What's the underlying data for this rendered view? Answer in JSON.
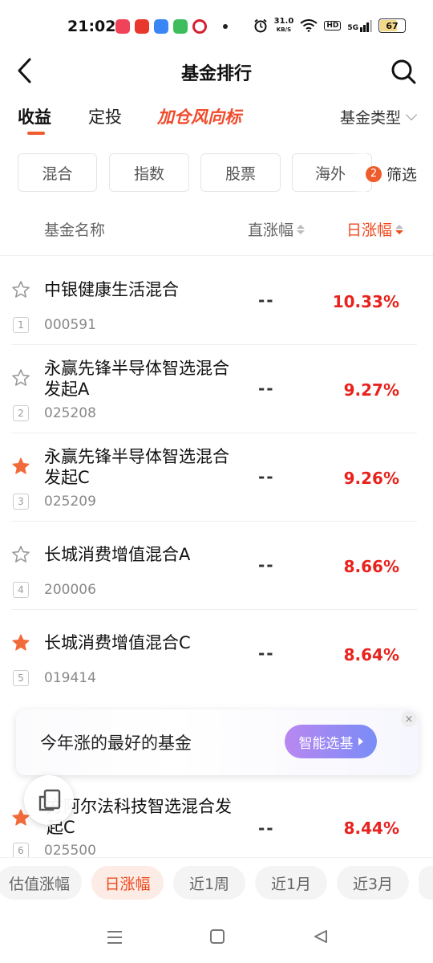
{
  "status_bar": {
    "time": "21:02",
    "net_speed_value": "31.0",
    "net_speed_unit": "KB/S",
    "hd": "HD",
    "signal": "5G",
    "battery": "67"
  },
  "header": {
    "title": "基金排行"
  },
  "tabs": {
    "items": [
      "收益",
      "定投"
    ],
    "special": "加仓风向标",
    "fund_type": "基金类型"
  },
  "filters": {
    "chips": [
      "混合",
      "指数",
      "股票",
      "海外"
    ],
    "filter_label": "筛选",
    "filter_count": "2"
  },
  "columns": {
    "name": "基金名称",
    "estimate": "直涨幅",
    "daily": "日涨幅"
  },
  "funds": [
    {
      "rank": "1",
      "name": "中银健康生活混合",
      "code": "000591",
      "estimate": "--",
      "daily": "10.33%",
      "starred": false
    },
    {
      "rank": "2",
      "name": "永赢先锋半导体智选混合发起A",
      "code": "025208",
      "estimate": "--",
      "daily": "9.27%",
      "starred": false
    },
    {
      "rank": "3",
      "name": "永赢先锋半导体智选混合发起C",
      "code": "025209",
      "estimate": "--",
      "daily": "9.26%",
      "starred": true
    },
    {
      "rank": "4",
      "name": "长城消费增值混合A",
      "code": "200006",
      "estimate": "--",
      "daily": "8.66%",
      "starred": false
    },
    {
      "rank": "5",
      "name": "长城消费增值混合C",
      "code": "019414",
      "estimate": "--",
      "daily": "8.64%",
      "starred": true
    },
    {
      "rank": "6",
      "name": "方阿尔法科技智选混合发起C",
      "code": "025500",
      "estimate": "--",
      "daily": "8.44%",
      "starred": true
    }
  ],
  "promo": {
    "text": "今年涨的最好的基金",
    "button": "智能选基",
    "close": "×"
  },
  "periods": [
    "估值涨幅",
    "日涨幅",
    "近1周",
    "近1月",
    "近3月"
  ],
  "active_period": "日涨幅",
  "colors": {
    "accent": "#ef5b2b",
    "rise": "#e8221d",
    "star_filled": "#f26a3a"
  }
}
